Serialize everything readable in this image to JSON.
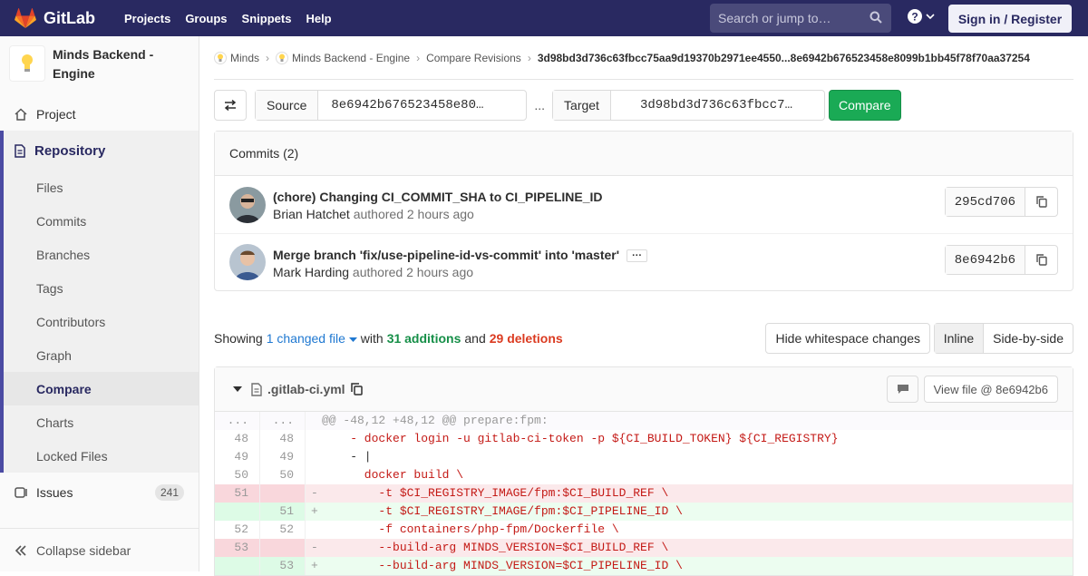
{
  "topbar": {
    "brand": "GitLab",
    "nav": [
      "Projects",
      "Groups",
      "Snippets",
      "Help"
    ],
    "search_placeholder": "Search or jump to…",
    "signin_label": "Sign in / Register"
  },
  "sidebar": {
    "project_name": "Minds Backend - Engine",
    "project_label": "Project",
    "repository_label": "Repository",
    "repo_items": [
      "Files",
      "Commits",
      "Branches",
      "Tags",
      "Contributors",
      "Graph",
      "Compare",
      "Charts",
      "Locked Files"
    ],
    "active_item": "Compare",
    "issues_label": "Issues",
    "issues_count": "241",
    "collapse_label": "Collapse sidebar"
  },
  "breadcrumbs": {
    "group": "Minds",
    "project": "Minds Backend - Engine",
    "section": "Compare Revisions",
    "current": "3d98bd3d736c63fbcc75aa9d19370b2971ee4550...8e6942b676523458e8099b1bb45f78f70aa37254"
  },
  "compare": {
    "source_label": "Source",
    "source_value": "8e6942b676523458e80…",
    "dots": "...",
    "target_label": "Target",
    "target_value": "3d98bd3d736c63fbcc7…",
    "button_label": "Compare"
  },
  "commits": {
    "header": "Commits (2)",
    "items": [
      {
        "title": "(chore) Changing CI_COMMIT_SHA to CI_PIPELINE_ID",
        "author": "Brian Hatchet",
        "meta": "authored 2 hours ago",
        "sha": "295cd706"
      },
      {
        "title": "Merge branch 'fix/use-pipeline-id-vs-commit' into 'master'",
        "author": "Mark Harding",
        "meta": "authored 2 hours ago",
        "sha": "8e6942b6"
      }
    ]
  },
  "stats": {
    "showing": "Showing",
    "changed": "1 changed file",
    "with": "with",
    "additions": "31 additions",
    "and": "and",
    "deletions": "29 deletions",
    "whitespace_btn": "Hide whitespace changes",
    "inline_btn": "Inline",
    "side_btn": "Side-by-side"
  },
  "file": {
    "name": ".gitlab-ci.yml",
    "view_btn": "View file @ 8e6942b6",
    "lines": [
      {
        "type": "hunk",
        "old": "...",
        "new": "...",
        "code": "@@ -48,12 +48,12 @@ prepare:fpm:"
      },
      {
        "type": "ctx",
        "old": "48",
        "new": "48",
        "code": "    - docker login -u gitlab-ci-token -p ${CI_BUILD_TOKEN} ${CI_REGISTRY}"
      },
      {
        "type": "ctx",
        "old": "49",
        "new": "49",
        "code": "    - |"
      },
      {
        "type": "ctx",
        "old": "50",
        "new": "50",
        "code": "      docker build \\"
      },
      {
        "type": "removed",
        "old": "51",
        "new": "",
        "code": "        -t $CI_REGISTRY_IMAGE/fpm:$CI_BUILD_REF \\"
      },
      {
        "type": "added",
        "old": "",
        "new": "51",
        "code": "        -t $CI_REGISTRY_IMAGE/fpm:$CI_PIPELINE_ID \\"
      },
      {
        "type": "ctx",
        "old": "52",
        "new": "52",
        "code": "        -f containers/php-fpm/Dockerfile \\"
      },
      {
        "type": "removed",
        "old": "53",
        "new": "",
        "code": "        --build-arg MINDS_VERSION=$CI_BUILD_REF \\"
      },
      {
        "type": "added",
        "old": "",
        "new": "53",
        "code": "        --build-arg MINDS_VERSION=$CI_PIPELINE_ID \\"
      }
    ]
  },
  "colors": {
    "topbar": "#292961",
    "accent": "#1aaa55",
    "link": "#1f78d1",
    "addition": "#168f48",
    "deletion": "#db3b21"
  }
}
